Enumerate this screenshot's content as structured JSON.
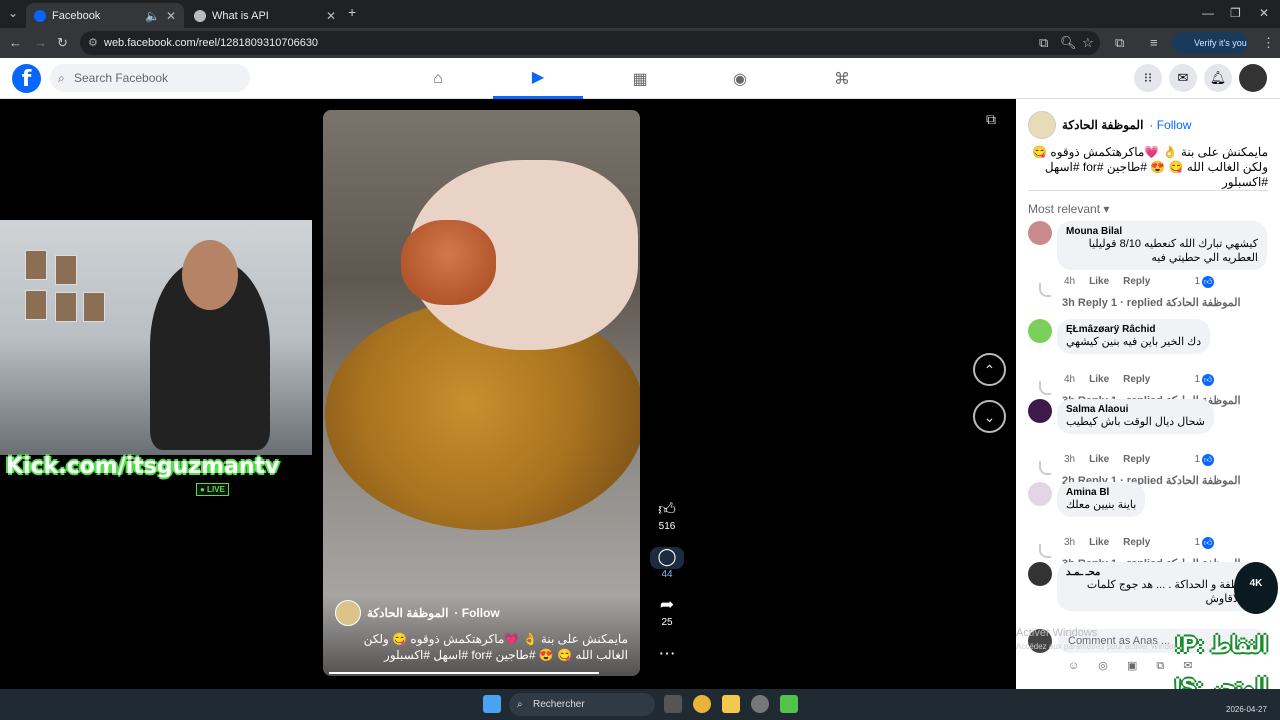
{
  "browser": {
    "tabs": [
      {
        "label": "Facebook",
        "active": true
      },
      {
        "label": "What is API",
        "active": false
      }
    ],
    "new_tab_label": "+",
    "url": "web.facebook.com/reel/1281809310706630",
    "verify_label": "Verify it's you"
  },
  "facebook": {
    "logo_letter": "f",
    "search_placeholder": "Search Facebook"
  },
  "reel": {
    "author": "الموظفة الحادكة",
    "follow_label": "· Follow",
    "caption": "مايمكنش على بنة 👌 💗ماكرهتكمش ذوقوه 😋 ولكن الغالب الله 😋 😍 #طاجين #for #اسهل #اكسبلور",
    "likes": "516",
    "comments": "44",
    "shares": "25"
  },
  "stream_overlay": {
    "kick_text": "Kick.com/itsguzmantv",
    "live_label": "● LIVE"
  },
  "panel": {
    "author": "الموظفة الحادكة",
    "follow_label": "· Follow",
    "caption": "مايمكنش على بنة 👌 💗ماكرهتكمش ذوقوه 😋 ولكن الغالب الله 😋 😍 #طاجين #for #اسهل #اكسبلور",
    "sort_label": "Most relevant ▾",
    "comments": [
      {
        "name": "Mouna Bilal",
        "text": "كيشهي تبارك الله كنعطيه 8/10 قوليليا العطريه الي حطيتي فيه",
        "time": "4h",
        "like": "Like",
        "reply": "Reply",
        "likes": "1",
        "replies": "3h Reply 1 · replied الموظفة الحادكة",
        "avatar_color": "#c98b8b"
      },
      {
        "name": "ĘŁmâzøarÿ Râchid",
        "text": "دك الخير باين فيه بنين كيشهي",
        "time": "4h",
        "like": "Like",
        "reply": "Reply",
        "likes": "1",
        "replies": "3h Reply 1 · replied الموظفة الحادكة",
        "avatar_color": "#7ccf5a"
      },
      {
        "name": "Salma Alaoui",
        "text": "شحال ديال الوقت باش كيطيب",
        "time": "3h",
        "like": "Like",
        "reply": "Reply",
        "likes": "1",
        "replies": "2h Reply 1 · replied الموظفة الحادكة",
        "avatar_color": "#3c1a4a"
      },
      {
        "name": "Amina Bl",
        "text": "باينة بنيين معلك",
        "time": "3h",
        "like": "Like",
        "reply": "Reply",
        "likes": "1",
        "replies": "3h Reply 1 · replied الموظفة الحادكة",
        "avatar_color": "#e5d4e8"
      },
      {
        "name": "محـ ـمـد",
        "text": "الموظفة و الحداكة . ... هد جوج كلمات مكيتلاقاوش",
        "time": "",
        "like": "",
        "reply": "",
        "likes": "",
        "replies": "",
        "avatar_color": "#333333"
      }
    ],
    "composer_placeholder": "Comment as Anas ...",
    "watermark": "Activer Windows",
    "watermark2": "Accédez aux paramètres pour activer Windows."
  },
  "overlays": {
    "ar_top": "النقاط :P!",
    "ar_bottom": "المتجر :S!",
    "logo_4k": "4K"
  },
  "taskbar": {
    "search_label": "Rechercher",
    "date": "2026-04-27"
  },
  "colors": {
    "fb_blue": "#0866ff",
    "kick_green": "#52e04a"
  }
}
